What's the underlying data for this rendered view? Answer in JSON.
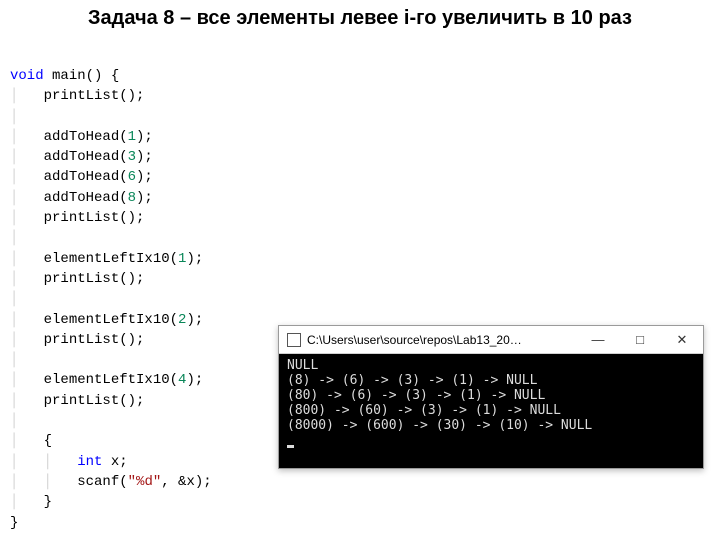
{
  "title": "Задача 8 – все элементы левее i-го увеличить в 10 раз",
  "code": {
    "l1a": "void",
    "l1b": " main() {",
    "l2": "printList();",
    "l3a": "addToHead(",
    "l3n": "1",
    "l3b": ");",
    "l4a": "addToHead(",
    "l4n": "3",
    "l4b": ");",
    "l5a": "addToHead(",
    "l5n": "6",
    "l5b": ");",
    "l6a": "addToHead(",
    "l6n": "8",
    "l6b": ");",
    "l7": "printList();",
    "l8a": "elementLeftIx10(",
    "l8n": "1",
    "l8b": ");",
    "l9": "printList();",
    "l10a": "elementLeftIx10(",
    "l10n": "2",
    "l10b": ");",
    "l11": "printList();",
    "l12a": "elementLeftIx10(",
    "l12n": "4",
    "l12b": ");",
    "l13": "printList();",
    "l14": "{",
    "l15a": "int",
    "l15b": " x;",
    "l16a": "scanf(",
    "l16s": "\"%d\"",
    "l16b": ", &x);",
    "l17": "}",
    "l18": "}"
  },
  "window": {
    "title": "C:\\Users\\user\\source\\repos\\Lab13_20…",
    "min": "—",
    "max": "□",
    "close": "✕"
  },
  "output": {
    "l1": "NULL",
    "l2": "(8) -> (6) -> (3) -> (1) -> NULL",
    "l3": "(80) -> (6) -> (3) -> (1) -> NULL",
    "l4": "(800) -> (60) -> (3) -> (1) -> NULL",
    "l5": "(8000) -> (600) -> (30) -> (10) -> NULL"
  }
}
